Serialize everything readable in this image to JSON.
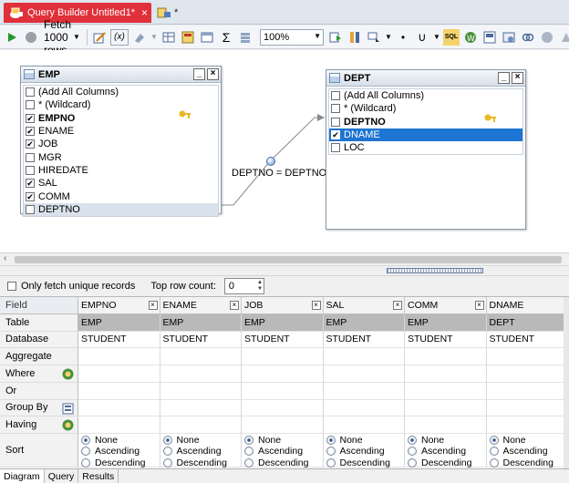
{
  "tabs": [
    {
      "label": "Query Builder Untitled1*",
      "close": "×",
      "active": true
    },
    {
      "label": "*",
      "active": false
    }
  ],
  "toolbar": {
    "fetch_label": "Fetch 1000 rows",
    "zoom_value": "100%"
  },
  "diagram": {
    "tables": [
      {
        "name": "EMP",
        "columns": [
          {
            "label": "(Add All Columns)",
            "checked": false,
            "bold": false
          },
          {
            "label": "* (Wildcard)",
            "checked": false,
            "bold": false
          },
          {
            "label": "EMPNO",
            "checked": true,
            "bold": true
          },
          {
            "label": "ENAME",
            "checked": true,
            "bold": false
          },
          {
            "label": "JOB",
            "checked": true,
            "bold": false
          },
          {
            "label": "MGR",
            "checked": false,
            "bold": false
          },
          {
            "label": "HIREDATE",
            "checked": false,
            "bold": false
          },
          {
            "label": "SAL",
            "checked": true,
            "bold": false
          },
          {
            "label": "COMM",
            "checked": true,
            "bold": false
          },
          {
            "label": "DEPTNO",
            "checked": false,
            "bold": false
          }
        ]
      },
      {
        "name": "DEPT",
        "columns": [
          {
            "label": "(Add All Columns)",
            "checked": false,
            "bold": false
          },
          {
            "label": "* (Wildcard)",
            "checked": false,
            "bold": false
          },
          {
            "label": "DEPTNO",
            "checked": false,
            "bold": true
          },
          {
            "label": "DNAME",
            "checked": true,
            "bold": false
          },
          {
            "label": "LOC",
            "checked": false,
            "bold": false
          }
        ]
      }
    ],
    "join_label": "DEPTNO = DEPTNO"
  },
  "options": {
    "unique_label": "Only fetch unique records",
    "top_row_label": "Top row count:",
    "top_row_value": "0"
  },
  "grid": {
    "row_labels": [
      "Field",
      "Table",
      "Database",
      "Aggregate",
      "Where",
      "Or",
      "Group By",
      "Having",
      "Sort"
    ],
    "columns": [
      {
        "field": "EMPNO",
        "table": "EMP",
        "database": "STUDENT"
      },
      {
        "field": "ENAME",
        "table": "EMP",
        "database": "STUDENT"
      },
      {
        "field": "JOB",
        "table": "EMP",
        "database": "STUDENT"
      },
      {
        "field": "SAL",
        "table": "EMP",
        "database": "STUDENT"
      },
      {
        "field": "COMM",
        "table": "EMP",
        "database": "STUDENT"
      },
      {
        "field": "DNAME",
        "table": "DEPT",
        "database": "STUDENT"
      }
    ],
    "sort_options": [
      "None",
      "Ascending",
      "Descending"
    ]
  },
  "bottom_tabs": [
    "Diagram",
    "Query",
    "Results"
  ],
  "colors": {
    "active_tab": "#e0303a",
    "selection": "#1e74d2"
  }
}
